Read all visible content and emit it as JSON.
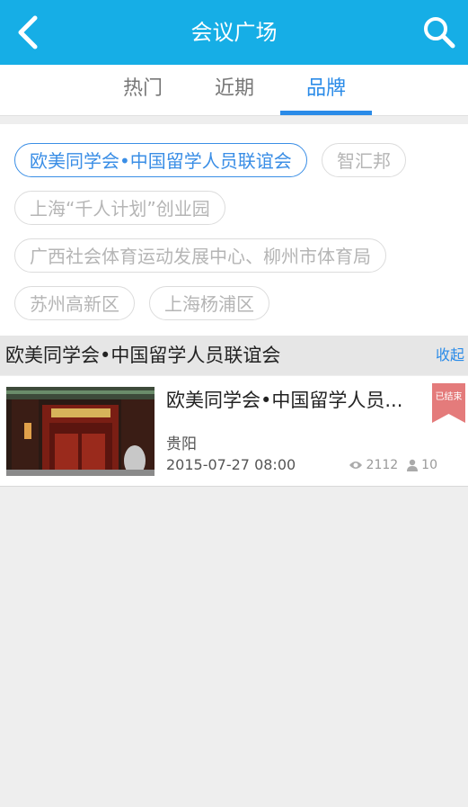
{
  "header": {
    "title": "会议广场"
  },
  "tabs": [
    {
      "label": "热门"
    },
    {
      "label": "近期"
    },
    {
      "label": "品牌",
      "active": true
    }
  ],
  "brands": [
    {
      "label": "欧美同学会•中国留学人员联谊会",
      "selected": true
    },
    {
      "label": "智汇邦"
    },
    {
      "label": "上海“千人计划”创业园"
    },
    {
      "label": "广西社会体育运动发展中心、柳州市体育局"
    },
    {
      "label": "苏州高新区"
    },
    {
      "label": "上海杨浦区"
    }
  ],
  "section": {
    "title": "欧美同学会•中国留学人员联谊会",
    "collapse_label": "收起"
  },
  "events": [
    {
      "title": "欧美同学会•中国留学人员...",
      "location": "贵阳",
      "datetime": "2015-07-27 08:00",
      "views": "2112",
      "attendees": "10",
      "status": "已结束"
    }
  ],
  "colors": {
    "accent": "#16aee6",
    "tab_active": "#2a8be8",
    "badge": "#e47b7b"
  },
  "icons": {
    "back": "back-arrow-icon",
    "search": "search-icon",
    "views": "eye-icon",
    "attendees": "person-icon"
  }
}
